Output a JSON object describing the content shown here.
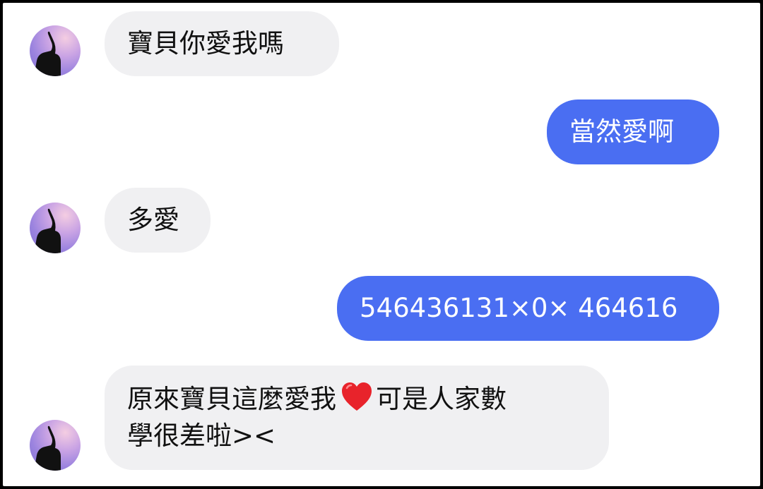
{
  "messages": [
    {
      "side": "in",
      "text": "寶貝你愛我嗎"
    },
    {
      "side": "out",
      "text": "當然愛啊"
    },
    {
      "side": "in",
      "text": "多愛"
    },
    {
      "side": "out",
      "text": "546436131×0× 464616"
    },
    {
      "side": "in",
      "line1_before": "原來寶貝這麼愛我",
      "heart_icon": "red-heart-icon",
      "line1_after": "可是人家數",
      "line2": "學很差啦><"
    }
  ],
  "colors": {
    "incoming_bubble": "#f0f0f2",
    "outgoing_bubble": "#4a6ef2",
    "heart": "#e8232b"
  }
}
